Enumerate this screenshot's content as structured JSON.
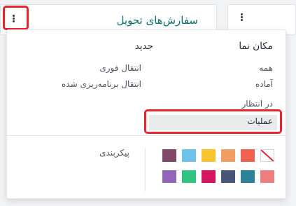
{
  "card": {
    "title": "سفارش‌های تحویل"
  },
  "dropdown": {
    "view": {
      "title": "مکان نما",
      "items": [
        "همه",
        "آماده",
        "در انتظار",
        "عملیات"
      ]
    },
    "new": {
      "title": "جدید",
      "items": [
        "انتقال فوری",
        "انتقال برنامه‌ریزی شده"
      ]
    },
    "configure": {
      "label": "پیکربندی"
    },
    "colors": {
      "row1": [
        "no-color",
        "#ef6150",
        "#f29e62",
        "#f6c42f",
        "#6ec3eb",
        "#814968"
      ],
      "row2": [
        "#eb7e7f",
        "#2c8397",
        "#475577",
        "#d6145f",
        "#30c381",
        "#9365b8"
      ]
    }
  }
}
